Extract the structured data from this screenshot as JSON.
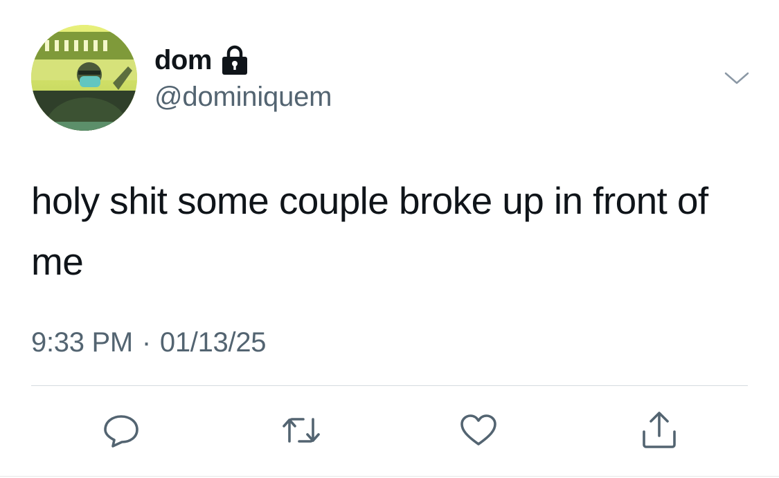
{
  "author": {
    "display_name": "dom",
    "handle": "@dominiquem",
    "protected": true,
    "avatar_icon": "profile-photo"
  },
  "tweet": {
    "text": "holy shit some couple broke up in front of me",
    "time": "9:33 PM",
    "separator": "·",
    "date": "01/13/25"
  },
  "actions": {
    "reply_icon": "speech-bubble",
    "retweet_icon": "retweet-arrows",
    "like_icon": "heart",
    "share_icon": "share-upload"
  },
  "colors": {
    "primary_text": "#0f1419",
    "secondary_text": "#536471",
    "icon": "#536471",
    "divider": "#d5dbdf"
  }
}
